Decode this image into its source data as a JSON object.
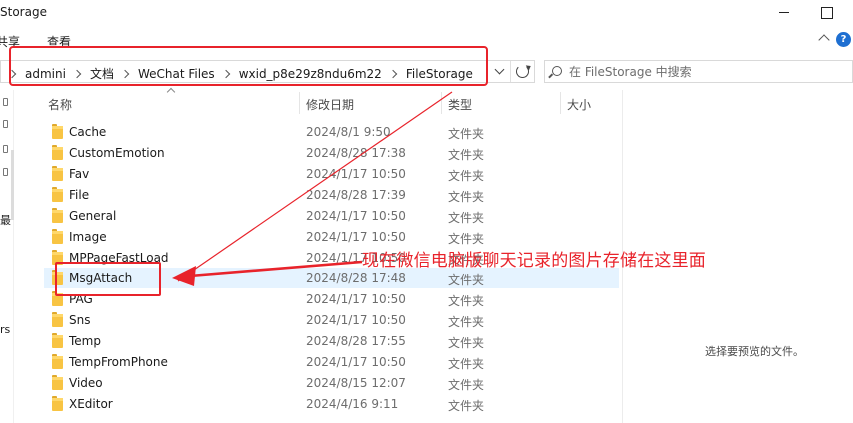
{
  "window": {
    "title": "Storage"
  },
  "ribbon": {
    "tabs": [
      {
        "label": "共享"
      },
      {
        "label": "查看"
      }
    ]
  },
  "address": {
    "crumbs": [
      "admini",
      "文档",
      "WeChat Files",
      "wxid_p8e29z8ndu6m22",
      "FileStorage"
    ]
  },
  "search": {
    "placeholder": "在 FileStorage 中搜索"
  },
  "nav": {
    "fragments": [
      "最",
      "rs"
    ]
  },
  "columns": {
    "name": "名称",
    "date": "修改日期",
    "type": "类型",
    "size": "大小"
  },
  "files": [
    {
      "name": "Cache",
      "date": "2024/8/1 9:50",
      "type": "文件夹"
    },
    {
      "name": "CustomEmotion",
      "date": "2024/8/28 17:38",
      "type": "文件夹"
    },
    {
      "name": "Fav",
      "date": "2024/1/17 10:50",
      "type": "文件夹"
    },
    {
      "name": "File",
      "date": "2024/8/28 17:39",
      "type": "文件夹"
    },
    {
      "name": "General",
      "date": "2024/1/17 10:50",
      "type": "文件夹"
    },
    {
      "name": "Image",
      "date": "2024/1/17 10:50",
      "type": "文件夹"
    },
    {
      "name": "MPPageFastLoad",
      "date": "2024/1/17 10:50",
      "type": "文件夹"
    },
    {
      "name": "MsgAttach",
      "date": "2024/8/28 17:48",
      "type": "文件夹"
    },
    {
      "name": "PAG",
      "date": "2024/1/17 10:50",
      "type": "文件夹"
    },
    {
      "name": "Sns",
      "date": "2024/1/17 10:50",
      "type": "文件夹"
    },
    {
      "name": "Temp",
      "date": "2024/8/28 17:55",
      "type": "文件夹"
    },
    {
      "name": "TempFromPhone",
      "date": "2024/1/17 10:50",
      "type": "文件夹"
    },
    {
      "name": "Video",
      "date": "2024/8/15 12:07",
      "type": "文件夹"
    },
    {
      "name": "XEditor",
      "date": "2024/4/16 9:11",
      "type": "文件夹"
    }
  ],
  "preview": {
    "message": "选择要预览的文件。"
  },
  "annotation": {
    "text": "现在微信电脑版聊天记录的图片存储在这里面",
    "color": "#e8232b"
  },
  "colors": {
    "folder": "#f8c443",
    "hover_row": "#e5f3ff",
    "help": "#1e6fd1"
  }
}
